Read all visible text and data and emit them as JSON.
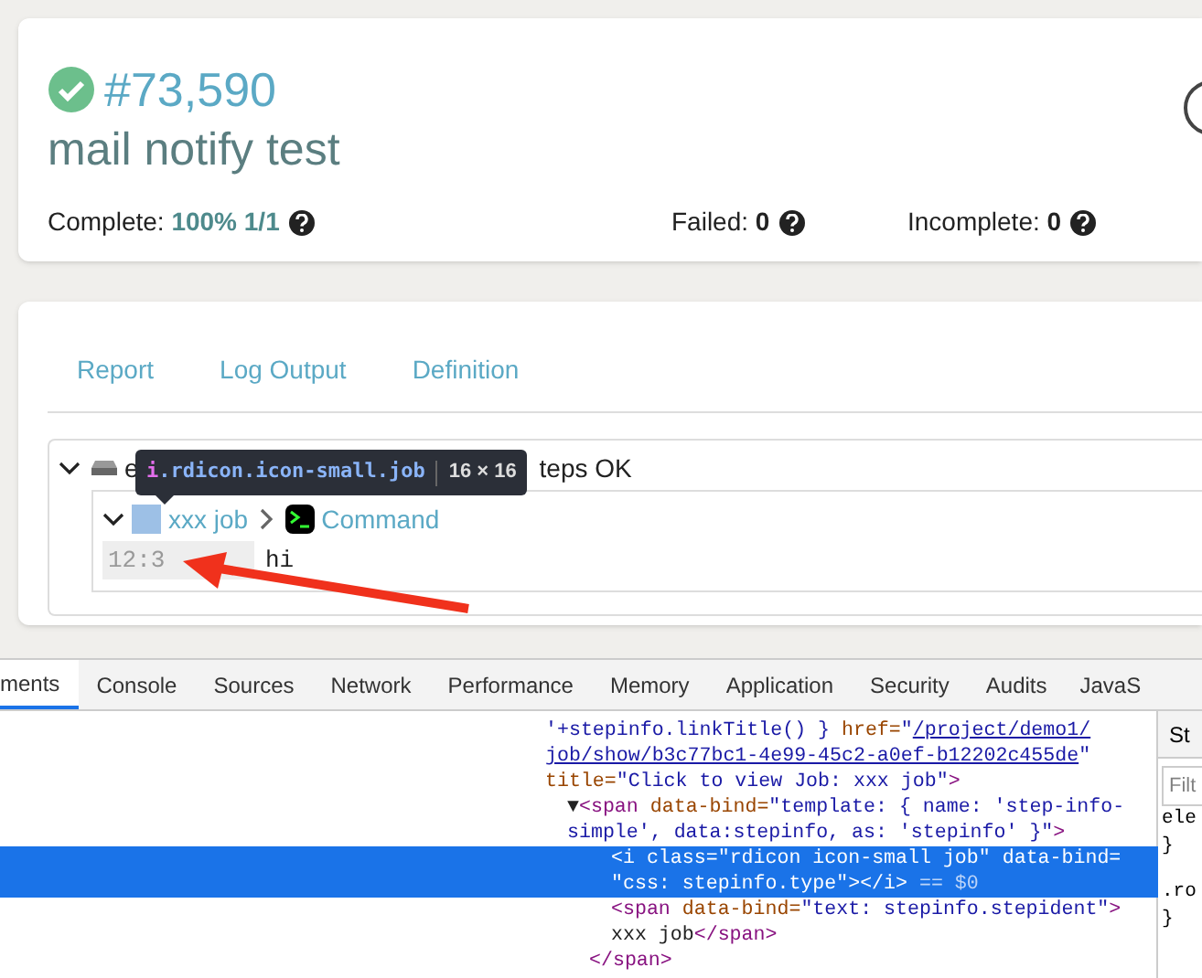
{
  "summary": {
    "success": true,
    "id": "#73,590",
    "title": "mail notify test",
    "stats": [
      {
        "label": "Complete:",
        "value": "100% 1/1",
        "kind": "success"
      },
      {
        "label": "Failed:",
        "value": "0",
        "kind": "plain"
      },
      {
        "label": "Incomplete:",
        "value": "0",
        "kind": "plain"
      }
    ]
  },
  "tabs": [
    {
      "label": "Report",
      "selected": false
    },
    {
      "label": "Log Output",
      "selected": false
    },
    {
      "label": "Definition",
      "selected": false
    }
  ],
  "report": {
    "node_prefix": "e",
    "node_suffix": "teps OK",
    "expanded": true,
    "step": {
      "expanded": true,
      "name": "xxx job",
      "type": "Command",
      "log": [
        {
          "time": "12:3",
          "text": "hi"
        }
      ]
    }
  },
  "tooltip": {
    "tag": "i",
    "selector": ".rdicon.icon-small.job",
    "size": "16 × 16"
  },
  "devtools": {
    "tabs": [
      {
        "label": "ments",
        "selected": true
      },
      {
        "label": "Console",
        "selected": false
      },
      {
        "label": "Sources",
        "selected": false
      },
      {
        "label": "Network",
        "selected": false
      },
      {
        "label": "Performance",
        "selected": false
      },
      {
        "label": "Memory",
        "selected": false
      },
      {
        "label": "Application",
        "selected": false
      },
      {
        "label": "Security",
        "selected": false
      },
      {
        "label": "Audits",
        "selected": false
      },
      {
        "label": "JavaS",
        "selected": false
      }
    ],
    "code": [
      {
        "segments": [
          {
            "kind": "value",
            "text": "'+stepinfo.linkTitle() }"
          },
          {
            "kind": "attr",
            "text": " href="
          },
          {
            "kind": "value",
            "text": "\""
          },
          {
            "kind": "link",
            "text": "/project/demo1/"
          }
        ]
      },
      {
        "segments": [
          {
            "kind": "link",
            "text": "job/show/b3c77bc1-4e99-45c2-a0ef-b12202c455de"
          },
          {
            "kind": "value",
            "text": "\""
          }
        ]
      },
      {
        "segments": [
          {
            "kind": "attr",
            "text": "title="
          },
          {
            "kind": "value",
            "text": "\"Click to view Job: xxx job\""
          },
          {
            "kind": "tag",
            "text": ">"
          }
        ]
      },
      {
        "children": [
          {
            "segments": [
              {
                "kind": "plain",
                "text": "▼"
              },
              {
                "kind": "tag",
                "text": "<span "
              },
              {
                "kind": "attr",
                "text": "data-bind="
              },
              {
                "kind": "value",
                "text": "\"template: { name: 'step-info-"
              }
            ]
          },
          {
            "segments": [
              {
                "kind": "value",
                "text": "simple', data:stepinfo, as: 'stepinfo' }\""
              },
              {
                "kind": "tag",
                "text": ">"
              }
            ]
          },
          {
            "children": [
              {
                "children": [
                  {
                    "selected": true,
                    "segments": [
                      {
                        "kind": "tag",
                        "text": "<i "
                      },
                      {
                        "kind": "attr",
                        "text": "class="
                      },
                      {
                        "kind": "value",
                        "text": "\"rdicon icon-small job\""
                      },
                      {
                        "kind": "attr",
                        "text": " data-bind="
                      }
                    ]
                  },
                  {
                    "selected": true,
                    "segments": [
                      {
                        "kind": "value",
                        "text": "\"css: stepinfo.type\""
                      },
                      {
                        "kind": "tag",
                        "text": "></i>"
                      },
                      {
                        "kind": "note",
                        "text": " == $0"
                      }
                    ]
                  },
                  {
                    "selected": false,
                    "segments": [
                      {
                        "kind": "tag",
                        "text": "<span "
                      },
                      {
                        "kind": "attr",
                        "text": "data-bind="
                      },
                      {
                        "kind": "value",
                        "text": "\"text: stepinfo.stepident\""
                      },
                      {
                        "kind": "tag",
                        "text": ">"
                      }
                    ]
                  },
                  {
                    "selected": false,
                    "segments": [
                      {
                        "kind": "plain",
                        "text": "xxx job"
                      },
                      {
                        "kind": "tag",
                        "text": "</span>"
                      }
                    ]
                  }
                ]
              },
              {
                "segments": [
                  {
                    "kind": "tag",
                    "text": "</span>"
                  }
                ]
              }
            ]
          }
        ]
      }
    ],
    "styles": {
      "tab": "St",
      "filter_placeholder": "Filt",
      "lines": [
        "ele",
        "}",
        ".ro",
        "}"
      ]
    }
  }
}
